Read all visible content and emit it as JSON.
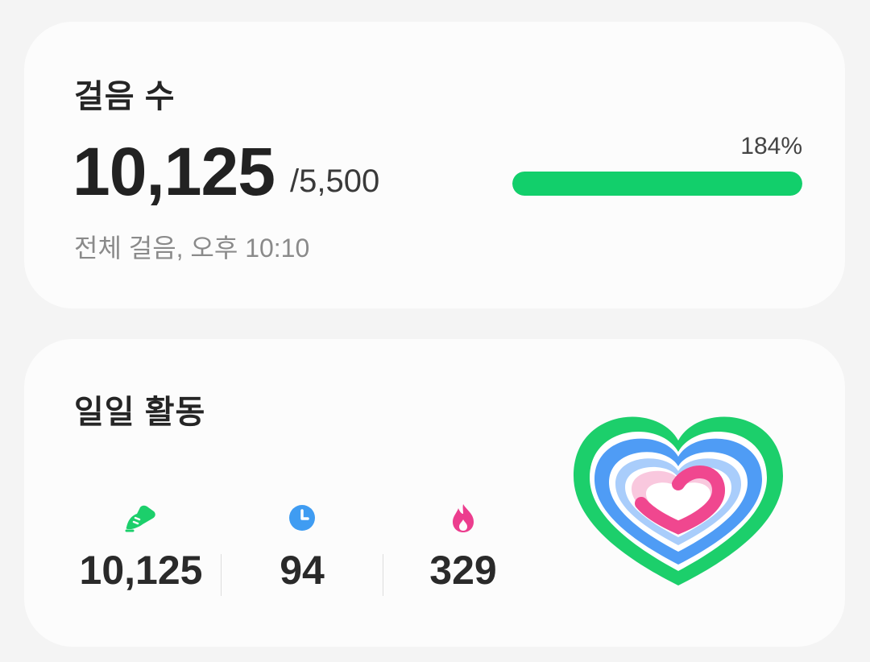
{
  "steps_card": {
    "title": "걸음 수",
    "value": "10,125",
    "goal": "/5,500",
    "subtitle": "전체 걸음, 오후 10:10",
    "progress_label": "184%",
    "progress_fraction": 1.0
  },
  "activity_card": {
    "title": "일일 활동",
    "stats": [
      {
        "icon": "shoe-icon",
        "value": "10,125",
        "color": "#1ccf6b"
      },
      {
        "icon": "clock-icon",
        "value": "94",
        "color": "#3f9cf2"
      },
      {
        "icon": "flame-icon",
        "value": "329",
        "color": "#ec3d8e"
      }
    ]
  },
  "colors": {
    "green": "#12cf6b",
    "blue": "#4f9cf5",
    "pink": "#f0478f",
    "card_bg": "#fcfcfc",
    "page_bg": "#f4f4f4"
  }
}
